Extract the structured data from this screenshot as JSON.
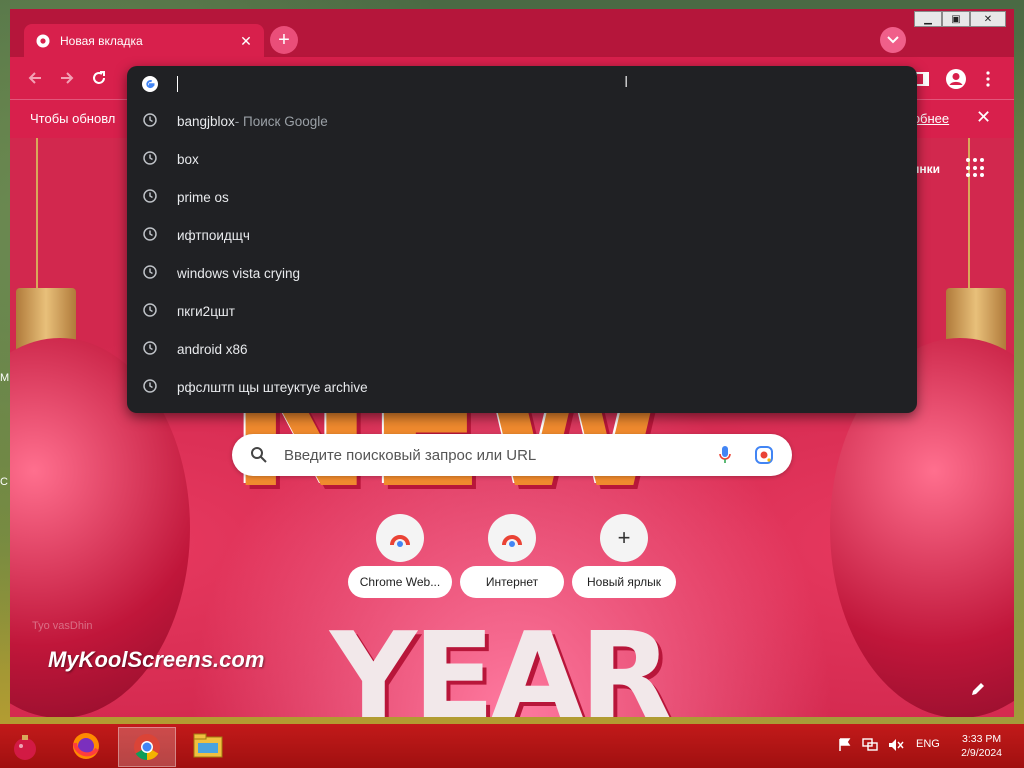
{
  "desktop": {
    "left_label_1": "M",
    "left_label_2": "C"
  },
  "browser": {
    "tab": {
      "title": "Новая вкладка"
    },
    "omnibox": {
      "value": "",
      "suggestions": [
        {
          "text": "bangjblox",
          "hint": " - Поиск Google"
        },
        {
          "text": "box",
          "hint": ""
        },
        {
          "text": "prime os",
          "hint": ""
        },
        {
          "text": "ифтпоидщч",
          "hint": ""
        },
        {
          "text": "windows vista crying",
          "hint": ""
        },
        {
          "text": "пкги2цшт",
          "hint": ""
        },
        {
          "text": "android x86",
          "hint": ""
        },
        {
          "text": "рфслштп щы штеуктуе archive",
          "hint": ""
        }
      ]
    },
    "infobar": {
      "message": "Чтобы обновл",
      "more_link": "дробнее",
      "close": "✕"
    },
    "ntp": {
      "top_link": "ртинки",
      "search_placeholder": "Введите поисковый запрос или URL",
      "shortcuts": [
        {
          "label": "Chrome Web..."
        },
        {
          "label": "Интернет"
        },
        {
          "label": "Новый ярлык"
        }
      ],
      "watermark": "MyKoolScreens.com",
      "faint_text": "Tyo vasDhin",
      "banner_top": "NEW",
      "banner_bottom": "YEAR"
    }
  },
  "taskbar": {
    "tray": {
      "lang": "ENG"
    },
    "time": "3:33 PM",
    "date": "2/9/2024"
  },
  "colors": {
    "accent": "#d8204c",
    "dropdown_bg": "#202124",
    "taskbar": "#b01414"
  }
}
